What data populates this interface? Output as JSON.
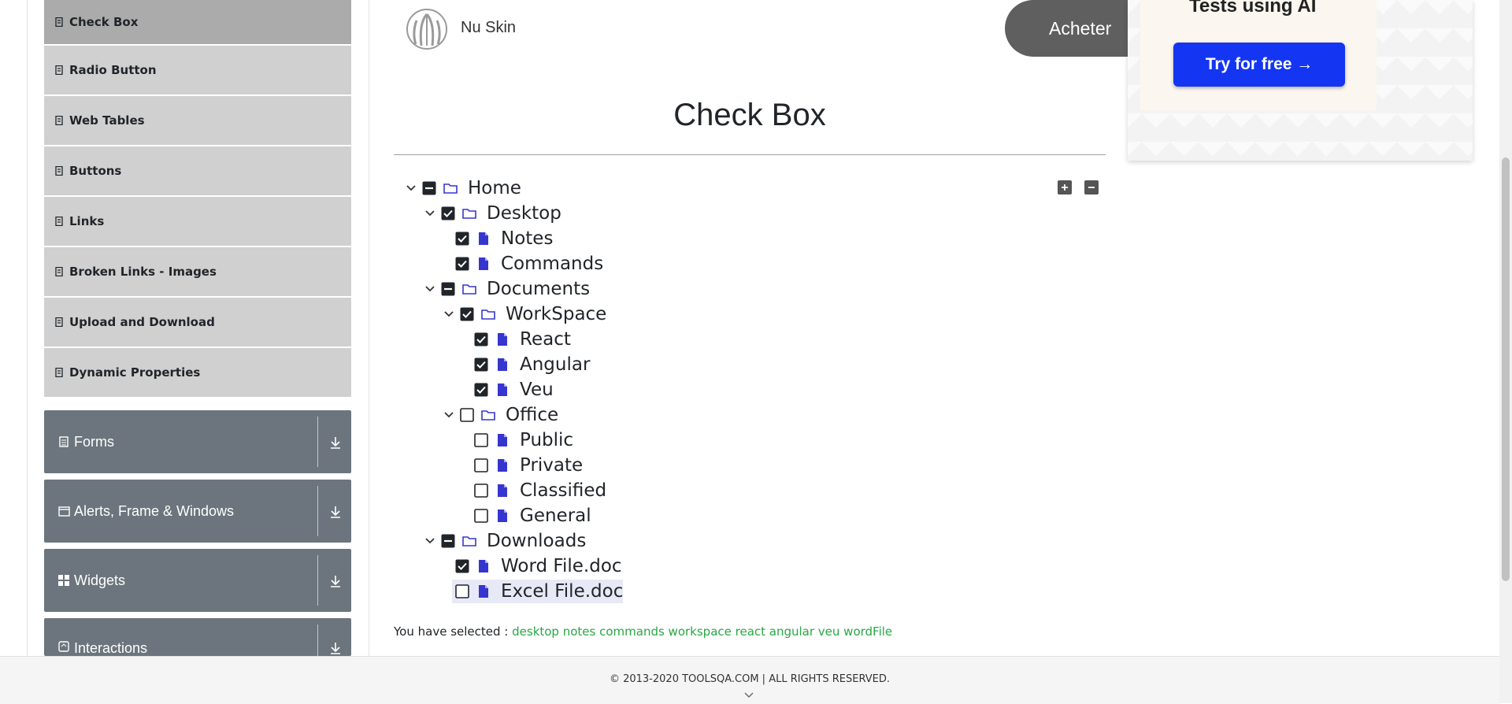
{
  "sidebar": {
    "items": [
      {
        "label": "Check Box",
        "active": true
      },
      {
        "label": "Radio Button"
      },
      {
        "label": "Web Tables"
      },
      {
        "label": "Buttons"
      },
      {
        "label": "Links"
      },
      {
        "label": "Broken Links - Images"
      },
      {
        "label": "Upload and Download"
      },
      {
        "label": "Dynamic Properties"
      }
    ],
    "groups": [
      {
        "label": "Forms",
        "icon": "form-icon"
      },
      {
        "label": "Alerts, Frame & Windows",
        "icon": "window-icon"
      },
      {
        "label": "Widgets",
        "icon": "widgets-icon"
      },
      {
        "label": "Interactions",
        "icon": "interactions-icon"
      }
    ]
  },
  "ad": {
    "brand": "Nu Skin",
    "buy_label": "Acheter",
    "heading": "Tests using AI",
    "cta_label": "Try for free →"
  },
  "main": {
    "title": "Check Box",
    "tree": [
      {
        "label": "Home",
        "state": "partial",
        "type": "folder",
        "expanded": true
      },
      {
        "label": "Desktop",
        "state": "checked",
        "type": "folder",
        "expanded": true
      },
      {
        "label": "Notes",
        "state": "checked",
        "type": "file"
      },
      {
        "label": "Commands",
        "state": "checked",
        "type": "file"
      },
      {
        "label": "Documents",
        "state": "partial",
        "type": "folder",
        "expanded": true
      },
      {
        "label": "WorkSpace",
        "state": "checked",
        "type": "folder",
        "expanded": true
      },
      {
        "label": "React",
        "state": "checked",
        "type": "file"
      },
      {
        "label": "Angular",
        "state": "checked",
        "type": "file"
      },
      {
        "label": "Veu",
        "state": "checked",
        "type": "file"
      },
      {
        "label": "Office",
        "state": "unchecked",
        "type": "folder",
        "expanded": true
      },
      {
        "label": "Public",
        "state": "unchecked",
        "type": "file"
      },
      {
        "label": "Private",
        "state": "unchecked",
        "type": "file"
      },
      {
        "label": "Classified",
        "state": "unchecked",
        "type": "file"
      },
      {
        "label": "General",
        "state": "unchecked",
        "type": "file"
      },
      {
        "label": "Downloads",
        "state": "partial",
        "type": "folder",
        "expanded": true
      },
      {
        "label": "Word File.doc",
        "state": "checked",
        "type": "file"
      },
      {
        "label": "Excel File.doc",
        "state": "unchecked",
        "type": "file",
        "highlighted": true
      }
    ],
    "result_prefix": "You have selected :",
    "result_values": "desktop notes commands workspace react angular veu wordFile"
  },
  "footer": {
    "text": "© 2013-2020 TOOLSQA.COM | ALL RIGHTS RESERVED."
  },
  "colors": {
    "accent": "#1436f2",
    "sidebar_item": "#d0d0d0",
    "sidebar_active": "#ababab",
    "group_bg": "#6c757d",
    "selected_text": "#28a745",
    "tree_icon": "#3636cf"
  }
}
